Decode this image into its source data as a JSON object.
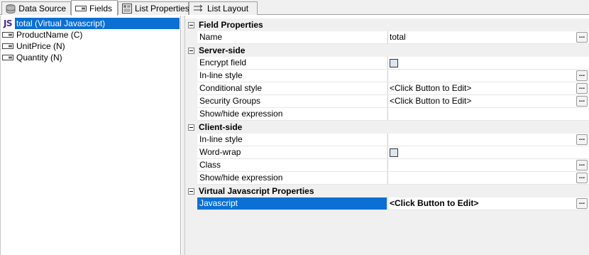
{
  "tabs": [
    {
      "label": "Data Source",
      "icon": "database-icon",
      "active": false
    },
    {
      "label": "Fields",
      "icon": "field-icon",
      "active": true
    },
    {
      "label": "List Properties",
      "icon": "list-properties-icon",
      "active": false
    },
    {
      "label": "List Layout",
      "icon": "list-layout-icon",
      "active": false
    }
  ],
  "fields": [
    {
      "label": "total (Virtual Javascript)",
      "icon": "js-icon",
      "badge": "JS",
      "selected": true
    },
    {
      "label": "ProductName (C)",
      "icon": "field-icon",
      "selected": false
    },
    {
      "label": "UnitPrice (N)",
      "icon": "field-icon",
      "selected": false
    },
    {
      "label": "Quantity (N)",
      "icon": "field-icon",
      "selected": false
    }
  ],
  "properties": {
    "field_properties": {
      "title": "Field Properties",
      "name_label": "Name",
      "name_value": "total"
    },
    "server_side": {
      "title": "Server-side",
      "encrypt_label": "Encrypt field",
      "encrypt_checked": false,
      "inline_style_label": "In-line style",
      "inline_style_value": "",
      "conditional_style_label": "Conditional style",
      "conditional_style_value": "<Click Button to Edit>",
      "security_groups_label": "Security Groups",
      "security_groups_value": "<Click Button to Edit>",
      "show_hide_label": "Show/hide expression",
      "show_hide_value": ""
    },
    "client_side": {
      "title": "Client-side",
      "inline_style_label": "In-line style",
      "inline_style_value": "",
      "word_wrap_label": "Word-wrap",
      "word_wrap_checked": false,
      "class_label": "Class",
      "class_value": "",
      "show_hide_label": "Show/hide expression",
      "show_hide_value": ""
    },
    "virtual_js": {
      "title": "Virtual Javascript Properties",
      "javascript_label": "Javascript",
      "javascript_value": "<Click Button to Edit>"
    },
    "ellipsis": "..."
  },
  "colors": {
    "selection": "#0b6fd4",
    "grid_bg": "#f0f0f0",
    "js_badge": "#4a2c8a"
  }
}
